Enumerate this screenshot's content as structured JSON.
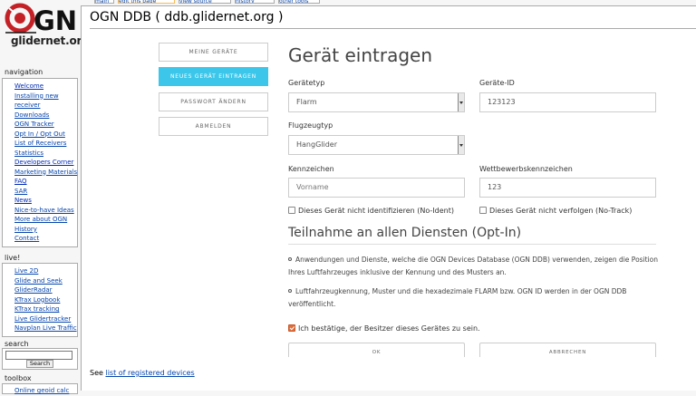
{
  "site": {
    "logo_text": "OGN",
    "logo_subtitle": "glidernet.org"
  },
  "tabs": [
    "main",
    "edit this page",
    "view source",
    "history",
    "other tools"
  ],
  "navigation": {
    "heading": "navigation",
    "items": [
      "Welcome",
      "Installing new",
      "receiver",
      "Downloads",
      "OGN Tracker",
      "Opt In / Opt Out",
      "List of Receivers",
      "Statistics",
      "Developers Corner",
      "Marketing Materials",
      "FAQ",
      "SAR",
      "News",
      "Nice-to-have Ideas",
      "More about OGN",
      "History",
      "Contact"
    ]
  },
  "live": {
    "heading": "live!",
    "items": [
      "Live 2D",
      "Glide and Seek",
      "GliderRadar",
      "KTrax Logbook",
      "KTrax tracking",
      "Live Glidertracker",
      "Navplan Live Traffic"
    ]
  },
  "search": {
    "heading": "search",
    "button": "Search"
  },
  "toolbox": {
    "heading": "toolbox",
    "items": [
      "Online geoid calc"
    ]
  },
  "page": {
    "title": "OGN DDB ( ddb.glidernet.org )"
  },
  "menu": {
    "my_devices": "MEINE GERÄTE",
    "new_device": "NEUES GERÄT EINTRAGEN",
    "change_password": "PASSWORT ÄNDERN",
    "logout": "ABMELDEN"
  },
  "form": {
    "title": "Gerät eintragen",
    "device_type_label": "Gerätetyp",
    "device_type_value": "Flarm",
    "device_id_label": "Geräte-ID",
    "device_id_value": "123123",
    "aircraft_type_label": "Flugzeugtyp",
    "aircraft_type_value": "HangGlider",
    "registration_label": "Kennzeichen",
    "registration_placeholder": "Vorname",
    "competition_label": "Wettbewerbskennzeichen",
    "competition_value": "123",
    "no_ident_label": "Dieses Gerät nicht identifizieren (No-Ident)",
    "no_track_label": "Dieses Gerät nicht verfolgen (No-Track)",
    "optin_title": "Teilnahme an allen Diensten (Opt-In)",
    "optin_para1": "Anwendungen und Dienste, welche die OGN Devices Database (OGN DDB) verwenden, zeigen die Position Ihres Luftfahrzeuges inklusive der Kennung und des Musters an.",
    "optin_para2": "Luftfahrzeugkennung, Muster und die hexadezimale FLARM bzw. OGN ID werden in der OGN DDB veröffentlicht.",
    "confirm_label": "Ich bestätige, der Besitzer dieses Gerätes zu sein.",
    "ok_button": "OK",
    "cancel_button": "ABBRECHEN"
  },
  "footer": {
    "prefix": "See",
    "link": "list of registered devices"
  },
  "colors": {
    "accent": "#3cc7ea",
    "checkbox": "#e0703c",
    "link": "#0645ad",
    "logo_red": "#c42127"
  }
}
